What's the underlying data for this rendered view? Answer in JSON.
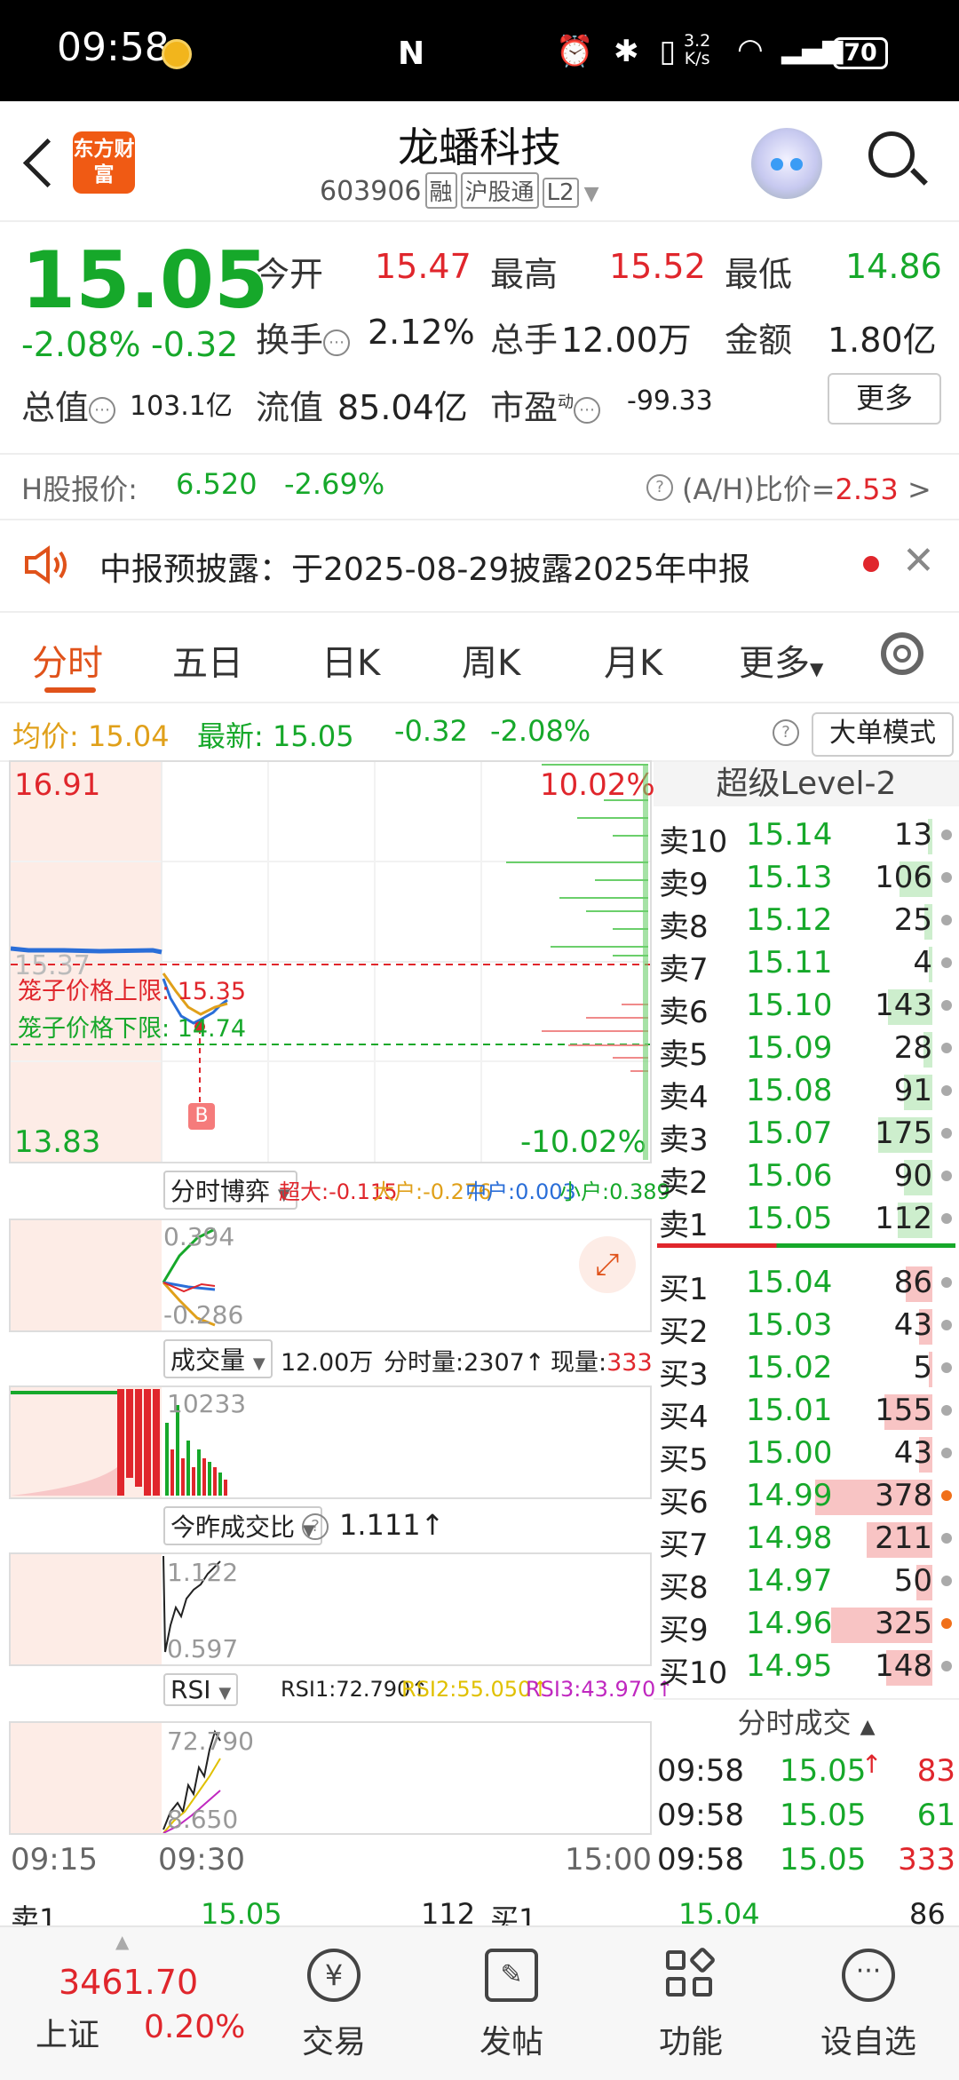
{
  "status_bar": {
    "time": "09:58",
    "nfc": "N",
    "speed_top": "3.2",
    "speed_bottom": "K/s",
    "battery": "70"
  },
  "header": {
    "logo_text": "东方财富",
    "stock_name": "龙蟠科技",
    "stock_code": "603906",
    "tags": [
      "融",
      "沪股通",
      "L2"
    ]
  },
  "quote": {
    "price": "15.05",
    "change_pct": "-2.08%",
    "change": "-0.32",
    "open_label": "今开",
    "open": "15.47",
    "high_label": "最高",
    "high": "15.52",
    "low_label": "最低",
    "low": "14.86",
    "turnover_label": "换手",
    "turnover": "2.12%",
    "volume_label": "总手",
    "volume": "12.00万",
    "amount_label": "金额",
    "amount": "1.80亿",
    "total_mv_label": "总值",
    "total_mv": "103.1亿",
    "float_mv_label": "流值",
    "float_mv": "85.04亿",
    "pe_label": "市盈",
    "pe_sup": "动",
    "pe": "-99.33",
    "more_button": "更多"
  },
  "h_share": {
    "label": "H股报价:",
    "price": "6.520",
    "change": "-2.69%",
    "ratio_label": "(A/H)比价=",
    "ratio": "2.53",
    "arrow": ">"
  },
  "notice": {
    "text": "中报预披露：于2025-08-29披露2025年中报"
  },
  "tabs": [
    "分时",
    "五日",
    "日K",
    "周K",
    "月K",
    "更多"
  ],
  "avg_row": {
    "avg_label": "均价:",
    "avg": "15.04",
    "latest_label": "最新:",
    "latest": "15.05",
    "change": "-0.32",
    "change_pct": "-2.08%",
    "mode_button": "大单模式"
  },
  "chart": {
    "y_max": "16.91",
    "y_min": "13.83",
    "pct_max": "10.02%",
    "pct_min": "-10.02%",
    "price_ghost": "15.37",
    "cage_upper_label": "笼子价格上限:",
    "cage_upper": "15.35",
    "cage_lower_label": "笼子价格下限:",
    "cage_lower": "14.74",
    "marker": "B",
    "time_start": "09:15",
    "time_mid": "09:30",
    "time_end": "15:00"
  },
  "game_panel": {
    "selector": "分时博弈",
    "super_label": "超大:",
    "super": "-0.115",
    "big_label": "大户:",
    "big": "-0.276",
    "mid_label": "中户:",
    "mid": "0.003",
    "small_label": "小户:",
    "small": "0.389",
    "max": "0.394",
    "min": "-0.286"
  },
  "volume_panel": {
    "selector": "成交量",
    "total": "12.00万",
    "minute_label": "分时量:",
    "minute": "2307↑",
    "now_label": "现量:",
    "now": "333",
    "max": "10233"
  },
  "ratio_panel": {
    "selector": "今昨成交比",
    "value": "1.111↑",
    "max": "1.122",
    "min": "0.597"
  },
  "rsi_panel": {
    "selector": "RSI",
    "rsi1": "RSI1:72.790↑",
    "rsi2": "RSI2:55.050↑",
    "rsi3": "RSI3:43.970↑",
    "max": "72.790",
    "min": "8.650"
  },
  "order_book": {
    "title": "超级Level-2",
    "asks": [
      {
        "label": "卖10",
        "price": "15.14",
        "vol": "13"
      },
      {
        "label": "卖9",
        "price": "15.13",
        "vol": "106"
      },
      {
        "label": "卖8",
        "price": "15.12",
        "vol": "25"
      },
      {
        "label": "卖7",
        "price": "15.11",
        "vol": "4"
      },
      {
        "label": "卖6",
        "price": "15.10",
        "vol": "143"
      },
      {
        "label": "卖5",
        "price": "15.09",
        "vol": "28"
      },
      {
        "label": "卖4",
        "price": "15.08",
        "vol": "91"
      },
      {
        "label": "卖3",
        "price": "15.07",
        "vol": "175"
      },
      {
        "label": "卖2",
        "price": "15.06",
        "vol": "90"
      },
      {
        "label": "卖1",
        "price": "15.05",
        "vol": "112"
      }
    ],
    "bids": [
      {
        "label": "买1",
        "price": "15.04",
        "vol": "86"
      },
      {
        "label": "买2",
        "price": "15.03",
        "vol": "43"
      },
      {
        "label": "买3",
        "price": "15.02",
        "vol": "5"
      },
      {
        "label": "买4",
        "price": "15.01",
        "vol": "155"
      },
      {
        "label": "买5",
        "price": "15.00",
        "vol": "43"
      },
      {
        "label": "买6",
        "price": "14.99",
        "vol": "378"
      },
      {
        "label": "买7",
        "price": "14.98",
        "vol": "211"
      },
      {
        "label": "买8",
        "price": "14.97",
        "vol": "50"
      },
      {
        "label": "买9",
        "price": "14.96",
        "vol": "325"
      },
      {
        "label": "买10",
        "price": "14.95",
        "vol": "148"
      }
    ],
    "trades_title": "分时成交",
    "trades": [
      {
        "time": "09:58",
        "price": "15.05",
        "vol": "83",
        "arrow": "↑"
      },
      {
        "time": "09:58",
        "price": "15.05",
        "vol": "61",
        "arrow": ""
      },
      {
        "time": "09:58",
        "price": "15.05",
        "vol": "333",
        "arrow": ""
      }
    ]
  },
  "peek_row": {
    "ask_label": "卖1",
    "ask_price": "15.05",
    "ask_vol": "112",
    "bid_label": "买1",
    "bid_price": "15.04",
    "bid_vol": "86"
  },
  "bottom_nav": {
    "index_value": "3461.70",
    "index_name": "上证",
    "index_change": "0.20%",
    "items": [
      "交易",
      "发帖",
      "功能",
      "设自选"
    ]
  }
}
